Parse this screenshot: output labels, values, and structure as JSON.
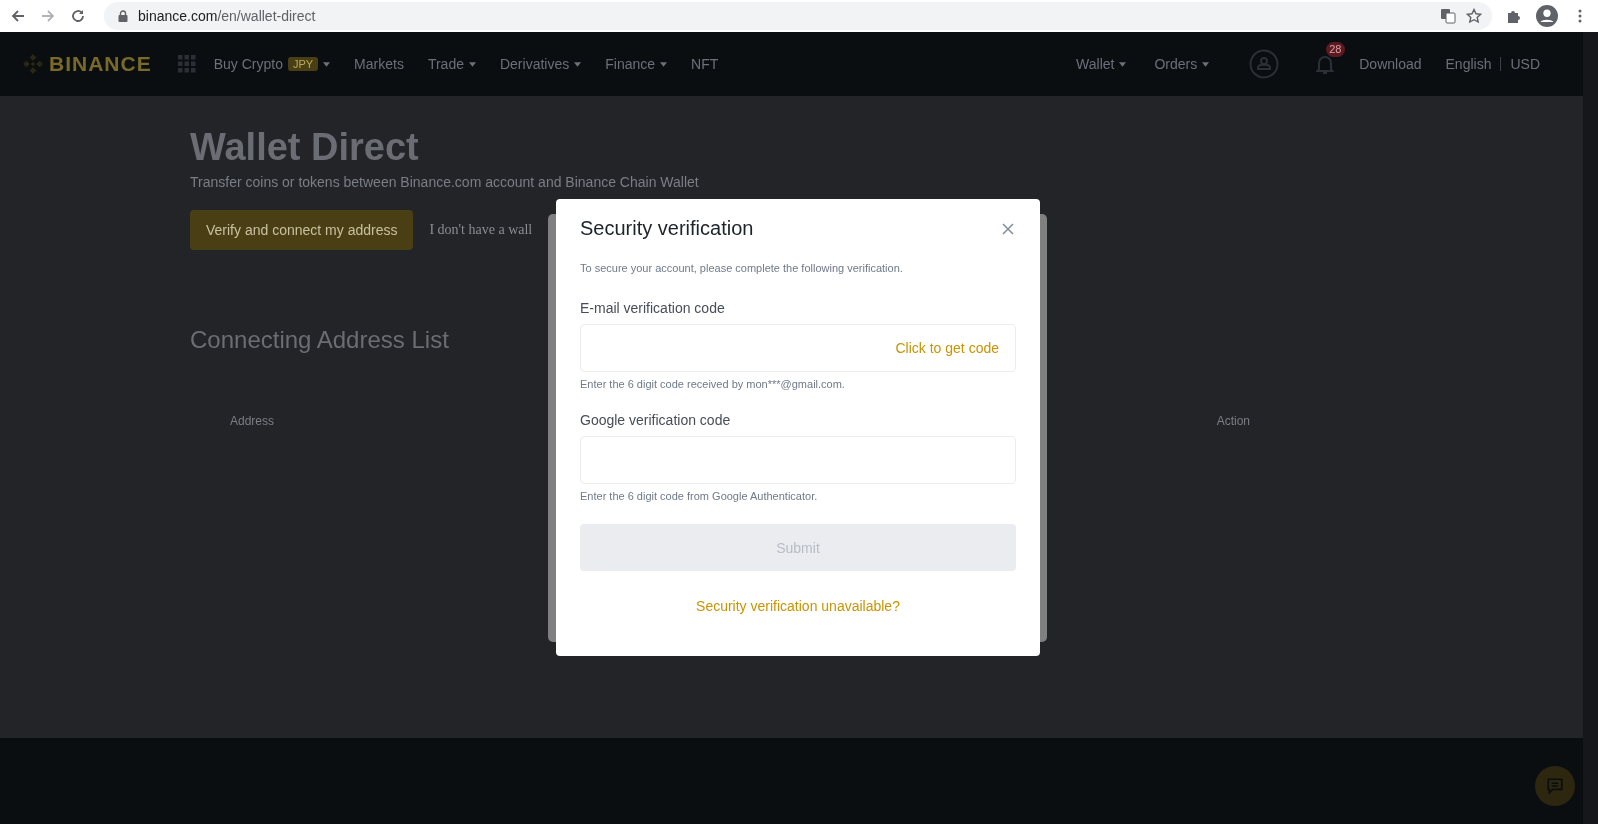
{
  "browser": {
    "url_host": "binance.com",
    "url_path": "/en/wallet-direct"
  },
  "nav": {
    "logo": "BINANCE",
    "left_items": [
      {
        "label": "Buy Crypto",
        "badge": "JPY",
        "dropdown": true
      },
      {
        "label": "Markets",
        "dropdown": false
      },
      {
        "label": "Trade",
        "dropdown": true
      },
      {
        "label": "Derivatives",
        "dropdown": true
      },
      {
        "label": "Finance",
        "dropdown": true
      },
      {
        "label": "NFT",
        "dropdown": false
      }
    ],
    "right_items": [
      {
        "label": "Wallet",
        "dropdown": true
      },
      {
        "label": "Orders",
        "dropdown": true
      }
    ],
    "notification_count": "28",
    "download": "Download",
    "language": "English",
    "currency": "USD"
  },
  "page": {
    "title": "Wallet Direct",
    "subtitle": "Transfer coins or tokens between Binance.com account and Binance Chain Wallet",
    "primary_button": "Verify and connect my address",
    "link": "I don't have a wall",
    "section_title": "Connecting Address List",
    "table": {
      "columns": [
        "Address",
        "Action"
      ]
    }
  },
  "modal": {
    "title": "Security verification",
    "description": "To secure your account, please complete the following verification.",
    "fields": [
      {
        "label": "E-mail verification code",
        "action": "Click to get code",
        "hint": "Enter the 6 digit code received by mon***@gmail.com."
      },
      {
        "label": "Google verification code",
        "hint": "Enter the 6 digit code from Google Authenticator."
      }
    ],
    "submit": {
      "label": "Submit",
      "disabled": true
    },
    "help_link": "Security verification unavailable?"
  }
}
